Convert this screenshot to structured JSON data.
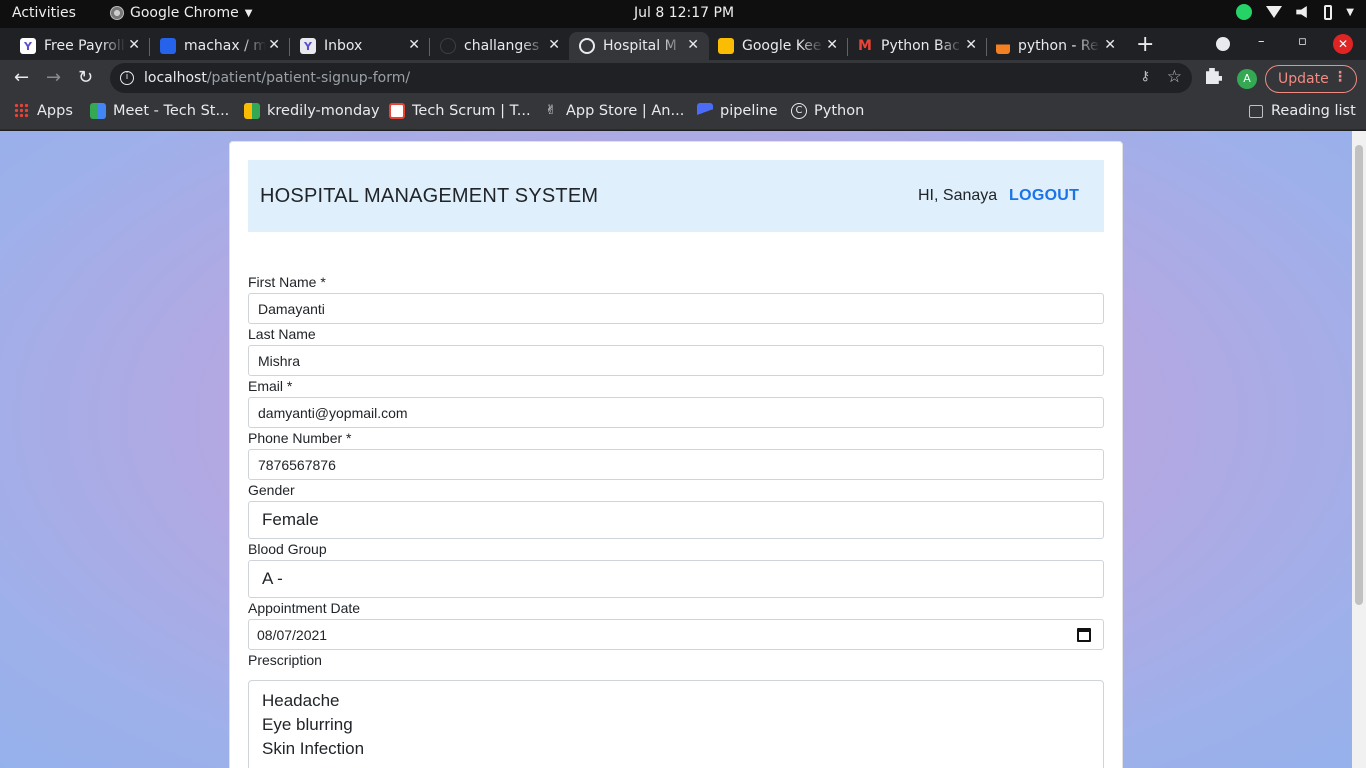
{
  "system_bar": {
    "activities": "Activities",
    "app_name": "Google Chrome",
    "clock": "Jul 8  12:17 PM"
  },
  "tabs": [
    {
      "label": "Free Payroll",
      "favicon": "Y",
      "color": "#ffffff"
    },
    {
      "label": "machax / m",
      "favicon": "b",
      "color": "#2563eb"
    },
    {
      "label": "Inbox",
      "favicon": "Y",
      "color": "#5b4fcf"
    },
    {
      "label": "challanges",
      "favicon": "",
      "color": "#202124"
    },
    {
      "label": "Hospital M",
      "favicon": "globe",
      "color": "#e8eaed"
    },
    {
      "label": "Google Kee",
      "favicon": "",
      "color": "#fbbc04"
    },
    {
      "label": "Python Bac",
      "favicon": "M",
      "color": "#ea4335"
    },
    {
      "label": "python - Re",
      "favicon": "",
      "color": "#f48024"
    }
  ],
  "address_bar": {
    "host": "localhost",
    "path": "/patient/patient-signup-form/"
  },
  "toolbar": {
    "update_label": "Update",
    "avatar_letter": "A"
  },
  "bookmarks": {
    "items": [
      {
        "label": "Apps"
      },
      {
        "label": "Meet - Tech St..."
      },
      {
        "label": "kredily-monday"
      },
      {
        "label": "Tech Scrum | T..."
      },
      {
        "label": "App Store | An..."
      },
      {
        "label": "pipeline"
      },
      {
        "label": "Python"
      }
    ],
    "reading_list": "Reading list"
  },
  "page": {
    "title": "HOSPITAL MANAGEMENT SYSTEM",
    "greeting": "HI, Sanaya",
    "logout": "LOGOUT",
    "form": {
      "first_name_label": "First Name *",
      "first_name_value": "Damayanti",
      "last_name_label": "Last Name",
      "last_name_value": "Mishra",
      "email_label": "Email *",
      "email_value": "damyanti@yopmail.com",
      "phone_label": "Phone Number *",
      "phone_value": "7876567876",
      "gender_label": "Gender",
      "gender_value": "Female",
      "blood_group_label": "Blood Group",
      "blood_group_value": "A -",
      "appointment_label": "Appointment Date",
      "appointment_value": "08/07/2021",
      "prescription_label": "Prescription",
      "prescription_lines": [
        "Headache",
        "Eye blurring",
        "Skin Infection"
      ]
    }
  }
}
